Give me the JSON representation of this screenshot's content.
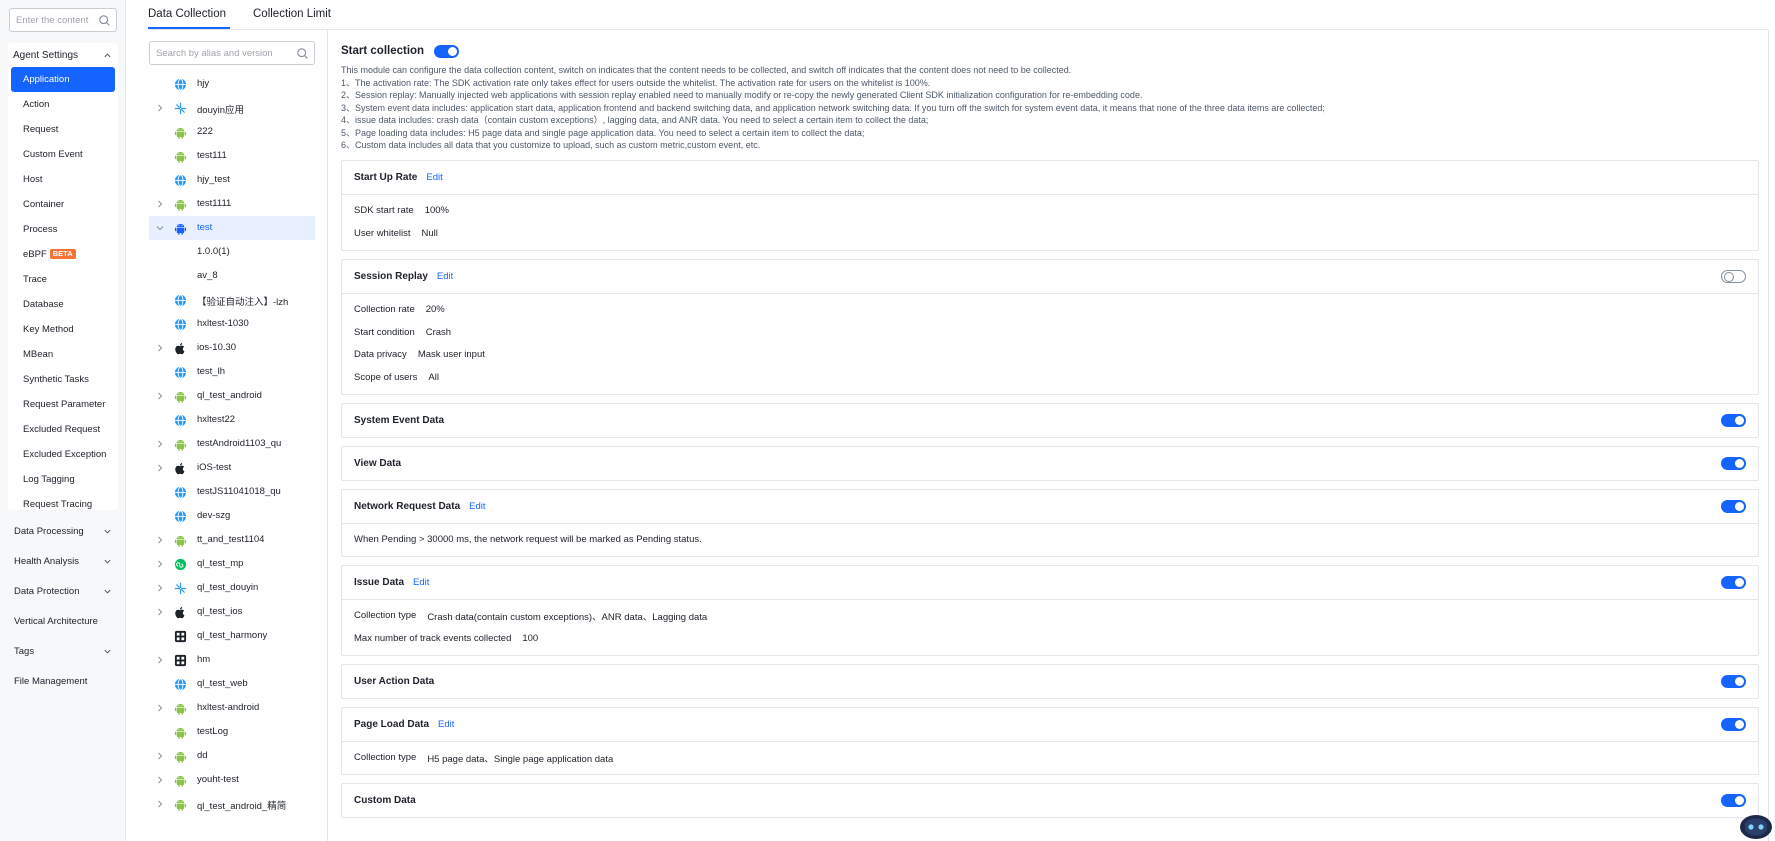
{
  "nav": {
    "search_placeholder": "Enter the content",
    "group_title": "Agent Settings",
    "items": [
      {
        "label": "Application",
        "active": true
      },
      {
        "label": "Action"
      },
      {
        "label": "Request"
      },
      {
        "label": "Custom Event"
      },
      {
        "label": "Host"
      },
      {
        "label": "Container"
      },
      {
        "label": "Process"
      },
      {
        "label": "eBPF",
        "badge": "BETA"
      },
      {
        "label": "Trace"
      },
      {
        "label": "Database"
      },
      {
        "label": "Key Method"
      },
      {
        "label": "MBean"
      },
      {
        "label": "Synthetic Tasks"
      },
      {
        "label": "Request Parameter"
      },
      {
        "label": "Excluded Request"
      },
      {
        "label": "Excluded Exception"
      },
      {
        "label": "Log Tagging"
      },
      {
        "label": "Request Tracing"
      }
    ],
    "sections": [
      {
        "label": "Data Processing",
        "expandable": true
      },
      {
        "label": "Health Analysis",
        "expandable": true
      },
      {
        "label": "Data Protection",
        "expandable": true
      },
      {
        "label": "Vertical Architecture",
        "expandable": false
      },
      {
        "label": "Tags",
        "expandable": true
      },
      {
        "label": "File Management",
        "expandable": false
      }
    ]
  },
  "tabs": [
    "Data Collection",
    "Collection Limit"
  ],
  "tree": {
    "search_placeholder": "Search by alias and version",
    "items": [
      {
        "label": "hjy",
        "icon": "web",
        "caret": ""
      },
      {
        "label": "douyin应用",
        "icon": "miniapp",
        "caret": "right"
      },
      {
        "label": "222",
        "icon": "android",
        "caret": ""
      },
      {
        "label": "test111",
        "icon": "android",
        "caret": ""
      },
      {
        "label": "hjy_test",
        "icon": "web",
        "caret": ""
      },
      {
        "label": "test1111",
        "icon": "android",
        "caret": "right"
      },
      {
        "label": "test",
        "icon": "android",
        "caret": "down",
        "selected": true
      },
      {
        "label": "1.0.0(1)",
        "icon": "",
        "caret": "",
        "child": true
      },
      {
        "label": "av_8",
        "icon": "",
        "caret": "",
        "child": true
      },
      {
        "label": "【验证自动注入】-lzh",
        "icon": "web",
        "caret": ""
      },
      {
        "label": "hxltest-1030",
        "icon": "web",
        "caret": ""
      },
      {
        "label": "ios-10.30",
        "icon": "apple",
        "caret": "right"
      },
      {
        "label": "test_lh",
        "icon": "web",
        "caret": ""
      },
      {
        "label": "ql_test_android",
        "icon": "android",
        "caret": "right"
      },
      {
        "label": "hxltest22",
        "icon": "web",
        "caret": ""
      },
      {
        "label": "testAndroid1103_qu",
        "icon": "android",
        "caret": "right"
      },
      {
        "label": "iOS-test",
        "icon": "apple",
        "caret": "right"
      },
      {
        "label": "testJS11041018_qu",
        "icon": "web",
        "caret": ""
      },
      {
        "label": "dev-szg",
        "icon": "web",
        "caret": ""
      },
      {
        "label": "tt_and_test1104",
        "icon": "android",
        "caret": "right"
      },
      {
        "label": "ql_test_mp",
        "icon": "wechat",
        "caret": "right"
      },
      {
        "label": "ql_test_douyin",
        "icon": "miniapp",
        "caret": "right"
      },
      {
        "label": "ql_test_ios",
        "icon": "apple",
        "caret": "right"
      },
      {
        "label": "ql_test_harmony",
        "icon": "harmony",
        "caret": ""
      },
      {
        "label": "hm",
        "icon": "harmony",
        "caret": "right"
      },
      {
        "label": "ql_test_web",
        "icon": "web",
        "caret": ""
      },
      {
        "label": "hxltest-android",
        "icon": "android",
        "caret": "right"
      },
      {
        "label": "testLog",
        "icon": "android",
        "caret": ""
      },
      {
        "label": "dd",
        "icon": "android",
        "caret": "right"
      },
      {
        "label": "youht-test",
        "icon": "android",
        "caret": "right"
      },
      {
        "label": "ql_test_android_精简",
        "icon": "android",
        "caret": "right"
      }
    ]
  },
  "content": {
    "start_collection": {
      "label": "Start collection",
      "enabled": true
    },
    "description": [
      "This module can configure the data collection content, switch on indicates that the content needs to be collected, and switch off indicates that the content does not need to be collected.",
      "1、The activation rate: The SDK activation rate only takes effect for users outside the whitelist. The activation rate for users on the whitelist is 100%.",
      "2、Session replay: Manually injected web applications with session replay enabled need to manually modify or re-copy the newly generated Client SDK initialization configuration for re-embedding code.",
      "3、System event data includes: application start data, application frontend and backend switching data, and application network switching data. If you turn off the switch for system event data, it means that none of the three data items are collected;",
      "4、issue data includes: crash data（contain custom exceptions）, lagging data, and ANR data. You need to select a certain item to collect the data;",
      "5、Page loading data includes: H5 page data and single page application data. You need to select a certain item to collect the data;",
      "6、Custom data includes all data that you customize to upload, such as custom metric,custom event, etc."
    ],
    "edit_label": "Edit",
    "cards": {
      "startup": {
        "title": "Start Up Rate",
        "rows": [
          {
            "k": "SDK start rate",
            "v": "100%"
          },
          {
            "k": "User whitelist",
            "v": "Null"
          }
        ]
      },
      "session": {
        "title": "Session Replay",
        "enabled": false,
        "rows": [
          {
            "k": "Collection rate",
            "v": "20%"
          },
          {
            "k": "Start condition",
            "v": "Crash"
          },
          {
            "k": "Data privacy",
            "v": "Mask user input"
          },
          {
            "k": "Scope of users",
            "v": "All"
          }
        ]
      },
      "system": {
        "title": "System Event Data",
        "enabled": true
      },
      "view": {
        "title": "View Data",
        "enabled": true
      },
      "network": {
        "title": "Network Request Data",
        "enabled": true,
        "note": "When Pending > 30000 ms, the network request will be marked as Pending status."
      },
      "issue": {
        "title": "Issue Data",
        "enabled": true,
        "rows": [
          {
            "k": "Collection type",
            "v": "Crash data(contain custom exceptions)、ANR data、Lagging data"
          },
          {
            "k": "Max number of track events collected",
            "v": "100"
          }
        ]
      },
      "useraction": {
        "title": "User Action Data",
        "enabled": true
      },
      "pageload": {
        "title": "Page Load Data",
        "enabled": true,
        "rows": [
          {
            "k": "Collection type",
            "v": "H5 page data、Single page application data"
          }
        ]
      },
      "custom": {
        "title": "Custom Data",
        "enabled": true
      }
    }
  },
  "colors": {
    "accent": "#1664ff",
    "beta": "#f77234",
    "android": "#8bc34a",
    "web": "#2b9af3"
  }
}
